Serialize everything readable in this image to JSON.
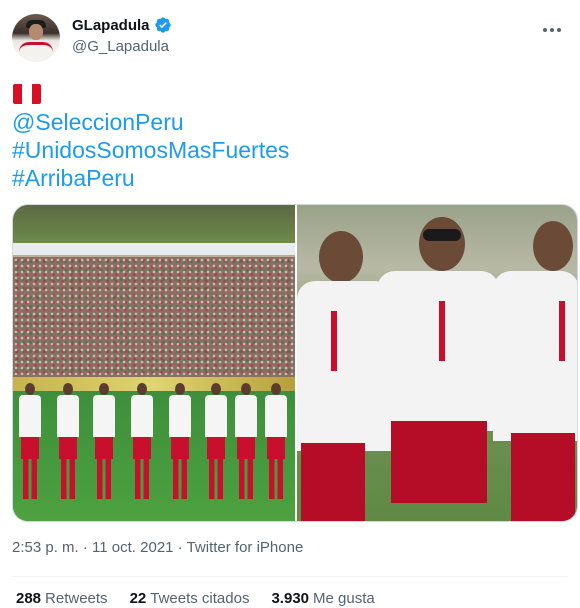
{
  "author": {
    "display_name": "GLapadula",
    "handle": "@G_Lapadula",
    "verified": true
  },
  "tweet": {
    "emoji": "flag-peru",
    "lines": [
      "@SeleccionPeru",
      "#UnidosSomosMasFuertes",
      "#ArribaPeru"
    ]
  },
  "meta": {
    "time": "2:53 p. m.",
    "separator": " · ",
    "date": "11 oct. 2021",
    "source": "Twitter for iPhone"
  },
  "stats": {
    "retweets_count": "288",
    "retweets_label": "Retweets",
    "quotes_count": "22",
    "quotes_label": "Tweets citados",
    "likes_count": "3.930",
    "likes_label": "Me gusta"
  },
  "colors": {
    "link": "#1d9bf0",
    "verified": "#1d9bf0",
    "flag_red": "#d91023",
    "muted": "#536471"
  }
}
